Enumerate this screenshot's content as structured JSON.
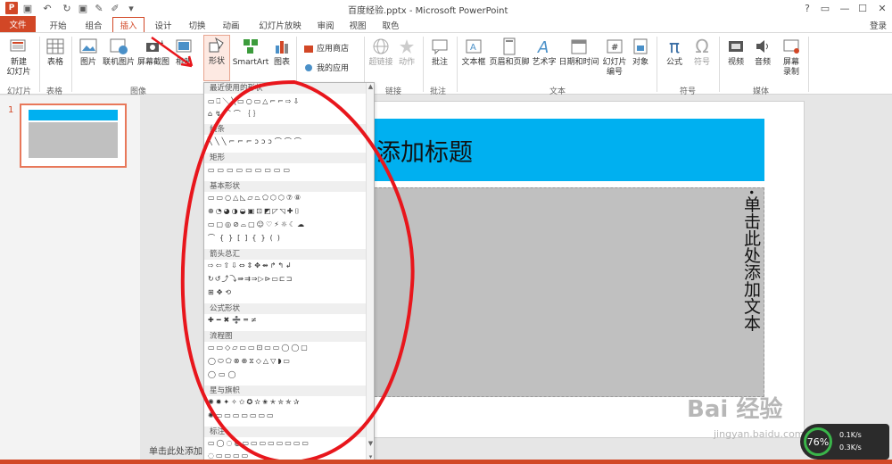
{
  "window": {
    "title": "百度经验.pptx - Microsoft PowerPoint",
    "help": "?",
    "controls": [
      "▭",
      "—",
      "☐",
      "✕"
    ],
    "login": "登录"
  },
  "tabs": [
    "文件",
    "开始",
    "组合",
    "插入",
    "设计",
    "切换",
    "动画",
    "幻灯片放映",
    "审阅",
    "视图",
    "取色"
  ],
  "ribbon": {
    "new_slide": "新建\n幻灯片",
    "new_slide_a": "新建",
    "new_slide_b": "幻灯片",
    "table": "表格",
    "picture": "图片",
    "online_picture": "联机图片",
    "screenshot": "屏幕截图",
    "album": "相册",
    "shapes": "形状",
    "smartart": "SmartArt",
    "chart": "图表",
    "app_store": "应用商店",
    "my_apps": "我的应用",
    "hyperlink": "超链接",
    "action": "动作",
    "comment": "批注",
    "textbox": "文本框",
    "header_footer": "页眉和页脚",
    "wordart": "艺术字",
    "datetime": "日期和时间",
    "slide_number_a": "幻灯片",
    "slide_number_b": "编号",
    "object": "对象",
    "equation": "公式",
    "symbol": "符号",
    "video": "视频",
    "audio": "音频",
    "screen_record_a": "屏幕",
    "screen_record_b": "录制",
    "groups": {
      "slides": "幻灯片",
      "tables": "表格",
      "images": "图像",
      "links": "链接",
      "comments": "批注",
      "text": "文本",
      "symbols": "符号",
      "media": "媒体"
    }
  },
  "thumbnail": {
    "number": "1"
  },
  "slide": {
    "title": "添加标题",
    "body_text": "单击此处添加文本",
    "bullet": "•"
  },
  "notes_hint": "单击此处添加",
  "gallery": {
    "sections": [
      "最近使用的形状",
      "线条",
      "矩形",
      "基本形状",
      "箭头总汇",
      "公式形状",
      "流程图",
      "星与旗帜",
      "标注"
    ],
    "recent_glyphs": "▭⎕＼╲▭○▭△⌐⌐⇨⇩",
    "recent_glyphs2": "⌂↯⌒⌒｛｝",
    "lines_glyphs": "╲╲╲⌐⌐⌐ↄↄↄ⌒⌒⌒",
    "rect_glyphs": "▭▭▭▭▭▭▭▭▭",
    "basic_glyphs1": "▭▭○△◺▱⏢⬠⬡⬡⑦⑧",
    "basic_glyphs2": "⊕◔◕◑◒▣⊡◩◸◹✚⌷",
    "basic_glyphs3": "▭▢◎⊘⌓▢☺♡⚡☼☾☁",
    "basic_glyphs4": "⌒{}[]{}()",
    "arrow_glyphs1": "⇨⇦⇧⇩⇔⇕✥⇴↱↰↲",
    "arrow_glyphs2": "↻↺⤴⤵⇛⇉⇒▷⊳▭⊏⊐",
    "arrow_glyphs3": "⊞✥⟲",
    "formula_glyphs": "✚━✖➗═≠",
    "flow_glyphs1": "▭▭◇▱▭▭⊡▭▭◯◯▢",
    "flow_glyphs2": "◯⬭⬠⊗⊕⧖◇△▽◗▭",
    "flow_glyphs3": "◯▭◯",
    "star_glyphs1": "✺✹✦✧✩✪✫✬✭✮✯✰",
    "star_glyphs2": "✺▭▭▭▭▭▭▭",
    "callout_glyphs": "▭◯◌◍▭▭▭▭▭▭▭▭",
    "callout_glyphs2": "◌▭▭▭▭"
  },
  "watermark": {
    "main": "Bai 经验",
    "sub": "jingyan.baidu.com"
  },
  "speed": {
    "percent": "76%",
    "up": "0.1K/s",
    "down": "0.3K/s"
  },
  "colors": {
    "accent": "#d24726",
    "title_fill": "#00b0f0",
    "content_fill": "#c0c0c0",
    "annotation": "#e8161c"
  }
}
